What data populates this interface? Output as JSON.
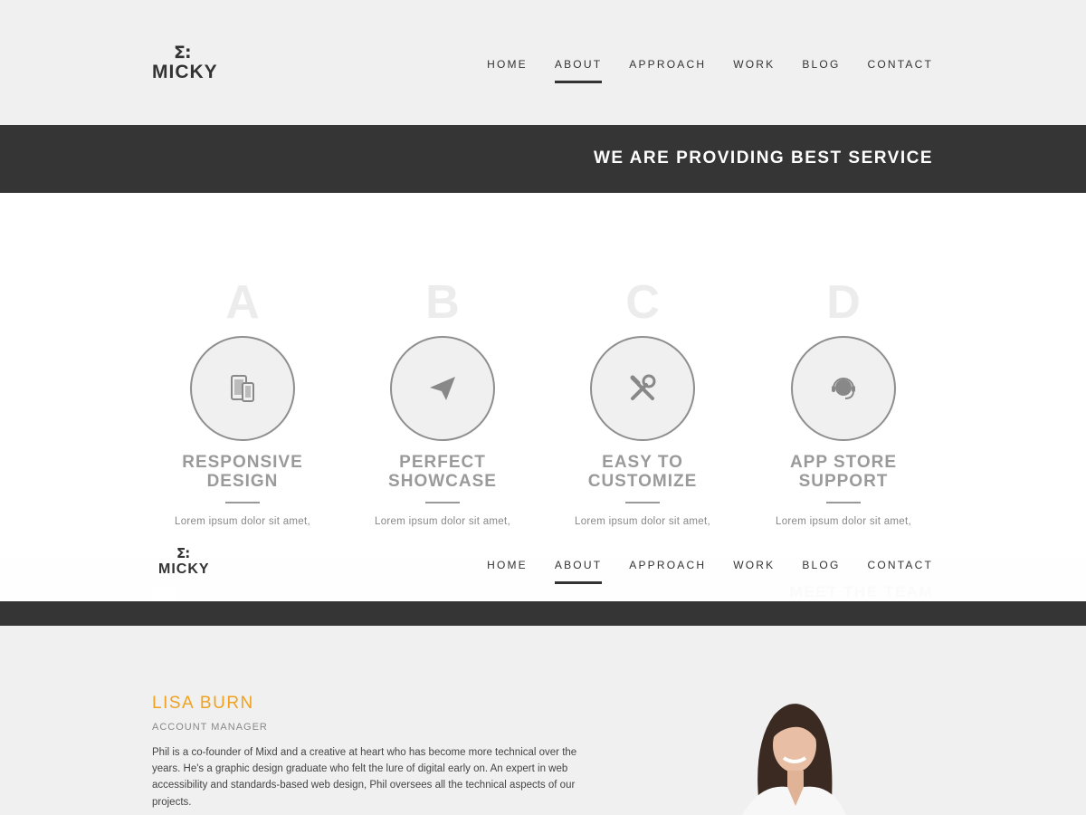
{
  "brand": {
    "logo_mark": "Σ:",
    "logo_text": "MICKY"
  },
  "nav": {
    "items": [
      "HOME",
      "ABOUT",
      "APPROACH",
      "WORK",
      "BLOG",
      "CONTACT"
    ],
    "active": "ABOUT"
  },
  "banner": {
    "title": "WE ARE PROVIDING BEST SERVICE"
  },
  "services": [
    {
      "letter": "A",
      "title_line1": "RESPONSIVE",
      "title_line2": "DESIGN",
      "text": "Lorem ipsum dolor sit amet,",
      "icon": "devices-icon"
    },
    {
      "letter": "B",
      "title_line1": "PERFECT",
      "title_line2": "SHOWCASE",
      "text": "Lorem ipsum dolor sit amet,",
      "icon": "paper-plane-icon"
    },
    {
      "letter": "C",
      "title_line1": "EASY TO",
      "title_line2": "CUSTOMIZE",
      "text": "Lorem ipsum dolor sit amet,",
      "icon": "tools-icon"
    },
    {
      "letter": "D",
      "title_line1": "APP STORE",
      "title_line2": "SUPPORT",
      "text": "Lorem ipsum dolor sit amet,",
      "icon": "headset-icon"
    }
  ],
  "team_section": {
    "title": "MEET THE TEAM"
  },
  "member": {
    "name": "LISA BURN",
    "role": "ACCOUNT MANAGER",
    "bio": "Phil is a co-founder of Mixd and a creative at heart who has become more technical over the years. He's a graphic design graduate who felt the lure of digital early on. An expert in web accessibility and standards-based web design, Phil oversees all the technical aspects of our projects."
  },
  "colors": {
    "dark": "#353535",
    "accent": "#f0a11f",
    "bg": "#f0f0f0"
  }
}
